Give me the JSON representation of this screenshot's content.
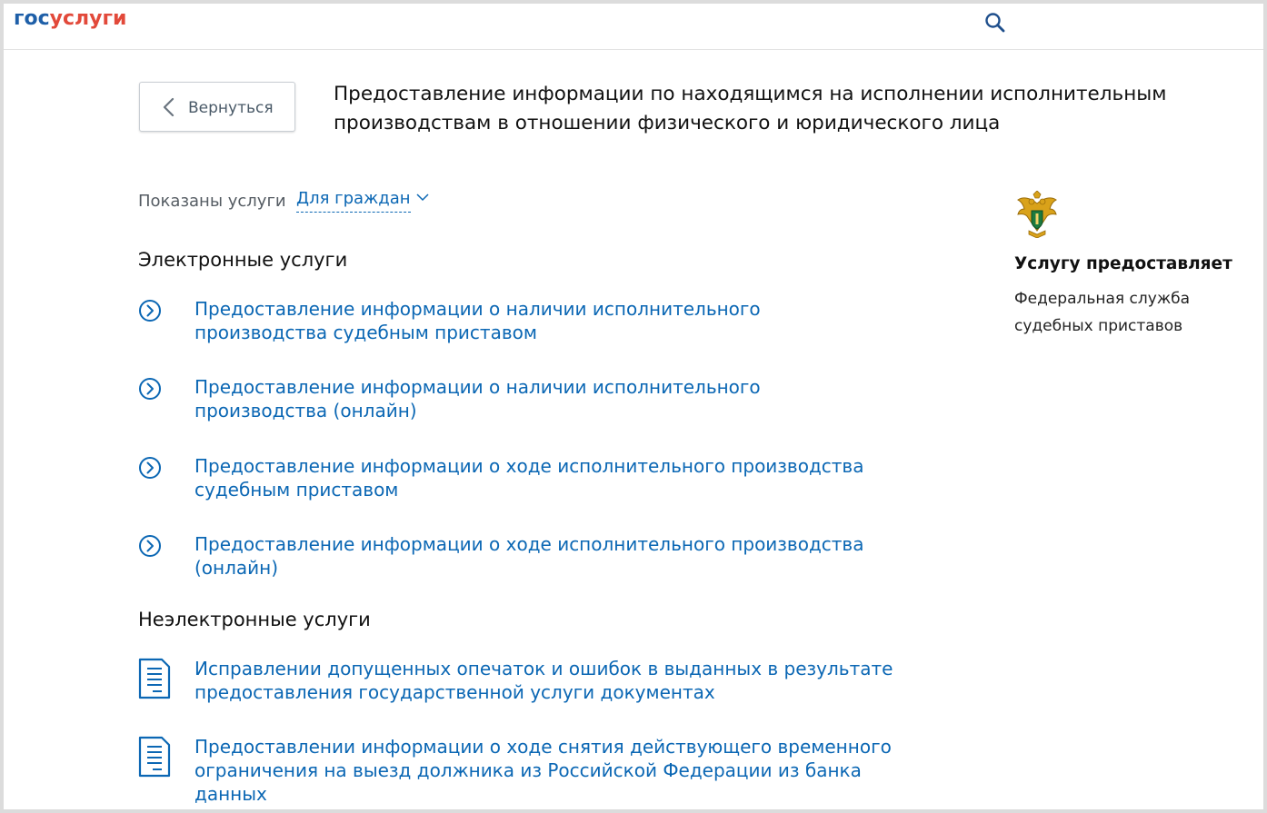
{
  "header": {
    "logo_part1": "гос",
    "logo_part2": "услуги",
    "search_icon": "search-icon"
  },
  "back_button": {
    "label": "Вернуться",
    "icon": "chevron-left-icon"
  },
  "page_title": "Предоставление информации по находящимся на исполнении исполнительным производствам в отношении физического и юридического лица",
  "filter": {
    "label": "Показаны услуги",
    "selected": "Для граждан",
    "icon": "chevron-down-icon"
  },
  "electronic_section": {
    "heading": "Электронные услуги",
    "items": [
      {
        "label": "Предоставление информации о наличии исполнительного производства судебным приставом"
      },
      {
        "label": "Предоставление информации о наличии исполнительного производства (онлайн)"
      },
      {
        "label": "Предоставление информации о ходе исполнительного производства судебным приставом"
      },
      {
        "label": "Предоставление информации о ходе исполнительного производства (онлайн)"
      }
    ]
  },
  "non_electronic_section": {
    "heading": "Неэлектронные услуги",
    "items": [
      {
        "label": "Исправлении допущенных опечаток и ошибок в выданных в результате предоставления государственной услуги документах"
      },
      {
        "label": "Предоставлении информации о ходе снятия действующего временного ограничения на выезд должника из Российской Федерации из банка данных"
      }
    ]
  },
  "provider": {
    "heading": "Услугу предоставляет",
    "name": "Федеральная служба судебных приставов",
    "emblem": "fssp-emblem-icon"
  },
  "colors": {
    "link": "#0b67b4",
    "logo_blue": "#1e5fa8",
    "logo_red": "#e2493a",
    "text": "#111111",
    "muted": "#555c63"
  }
}
